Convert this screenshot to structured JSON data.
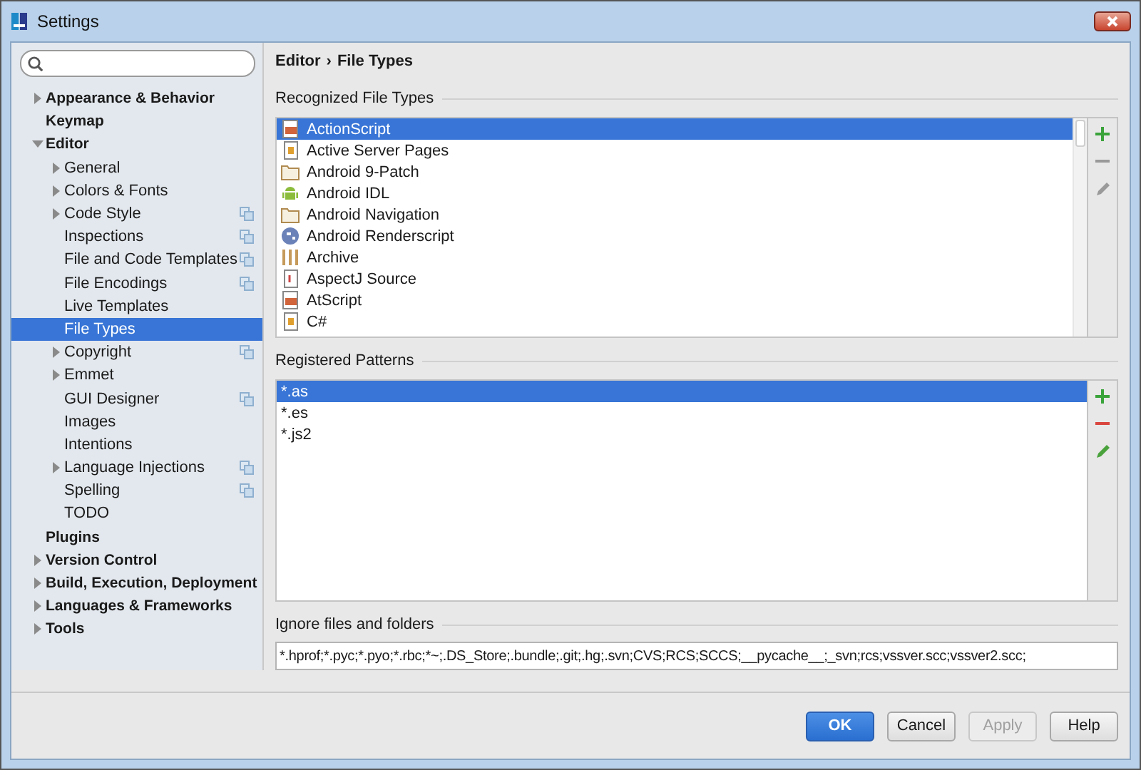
{
  "window": {
    "title": "Settings"
  },
  "sidebar": {
    "items": [
      {
        "label": "Appearance & Behavior",
        "expandable": true,
        "expanded": false,
        "selected": false,
        "project_scoped": false
      },
      {
        "label": "Keymap",
        "expandable": false,
        "expanded": false,
        "selected": false,
        "project_scoped": false
      },
      {
        "label": "Editor",
        "expandable": true,
        "expanded": true,
        "selected": false,
        "project_scoped": false,
        "children": [
          {
            "label": "General",
            "expandable": true,
            "expanded": false,
            "selected": false,
            "project_scoped": false
          },
          {
            "label": "Colors & Fonts",
            "expandable": true,
            "expanded": false,
            "selected": false,
            "project_scoped": false
          },
          {
            "label": "Code Style",
            "expandable": true,
            "expanded": false,
            "selected": false,
            "project_scoped": true
          },
          {
            "label": "Inspections",
            "expandable": false,
            "expanded": false,
            "selected": false,
            "project_scoped": true
          },
          {
            "label": "File and Code Templates",
            "expandable": false,
            "expanded": false,
            "selected": false,
            "project_scoped": true
          },
          {
            "label": "File Encodings",
            "expandable": false,
            "expanded": false,
            "selected": false,
            "project_scoped": true
          },
          {
            "label": "Live Templates",
            "expandable": false,
            "expanded": false,
            "selected": false,
            "project_scoped": false
          },
          {
            "label": "File Types",
            "expandable": false,
            "expanded": false,
            "selected": true,
            "project_scoped": false
          },
          {
            "label": "Copyright",
            "expandable": true,
            "expanded": false,
            "selected": false,
            "project_scoped": true
          },
          {
            "label": "Emmet",
            "expandable": true,
            "expanded": false,
            "selected": false,
            "project_scoped": false
          },
          {
            "label": "GUI Designer",
            "expandable": false,
            "expanded": false,
            "selected": false,
            "project_scoped": true
          },
          {
            "label": "Images",
            "expandable": false,
            "expanded": false,
            "selected": false,
            "project_scoped": false
          },
          {
            "label": "Intentions",
            "expandable": false,
            "expanded": false,
            "selected": false,
            "project_scoped": false
          },
          {
            "label": "Language Injections",
            "expandable": true,
            "expanded": false,
            "selected": false,
            "project_scoped": true
          },
          {
            "label": "Spelling",
            "expandable": false,
            "expanded": false,
            "selected": false,
            "project_scoped": true
          },
          {
            "label": "TODO",
            "expandable": false,
            "expanded": false,
            "selected": false,
            "project_scoped": false
          }
        ]
      },
      {
        "label": "Plugins",
        "expandable": false,
        "expanded": false,
        "selected": false,
        "project_scoped": false
      },
      {
        "label": "Version Control",
        "expandable": true,
        "expanded": false,
        "selected": false,
        "project_scoped": false
      },
      {
        "label": "Build, Execution, Deployment",
        "expandable": true,
        "expanded": false,
        "selected": false,
        "project_scoped": false
      },
      {
        "label": "Languages & Frameworks",
        "expandable": true,
        "expanded": false,
        "selected": false,
        "project_scoped": false
      },
      {
        "label": "Tools",
        "expandable": true,
        "expanded": false,
        "selected": false,
        "project_scoped": false
      }
    ]
  },
  "breadcrumb": {
    "parts": [
      "Editor",
      "File Types"
    ],
    "separator": "›"
  },
  "recognized_file_types": {
    "title": "Recognized File Types",
    "items": [
      {
        "label": "ActionScript",
        "kind": "badge",
        "selected": true
      },
      {
        "label": "Active Server Pages",
        "kind": "document",
        "selected": false
      },
      {
        "label": "Android 9-Patch",
        "kind": "folder",
        "selected": false
      },
      {
        "label": "Android IDL",
        "kind": "android",
        "selected": false
      },
      {
        "label": "Android Navigation",
        "kind": "folder",
        "selected": false
      },
      {
        "label": "Android Renderscript",
        "kind": "circle",
        "selected": false
      },
      {
        "label": "Archive",
        "kind": "archive",
        "selected": false
      },
      {
        "label": "AspectJ Source",
        "kind": "plain",
        "selected": false
      },
      {
        "label": "AtScript",
        "kind": "badge",
        "selected": false
      },
      {
        "label": "C#",
        "kind": "document",
        "selected": false
      }
    ],
    "toolbar": [
      {
        "kind": "add",
        "disabled": false
      },
      {
        "kind": "remove",
        "disabled": true
      },
      {
        "kind": "edit",
        "disabled": true
      }
    ]
  },
  "registered_patterns": {
    "title": "Registered Patterns",
    "items": [
      {
        "label": "*.as",
        "selected": true
      },
      {
        "label": "*.es",
        "selected": false
      },
      {
        "label": "*.js2",
        "selected": false
      }
    ],
    "toolbar": [
      {
        "kind": "add",
        "disabled": false
      },
      {
        "kind": "remove",
        "disabled": false
      },
      {
        "kind": "edit",
        "disabled": false
      }
    ]
  },
  "ignore_files": {
    "label": "Ignore files and folders",
    "value": "*.hprof;*.pyc;*.pyo;*.rbc;*~;.DS_Store;.bundle;.git;.hg;.svn;CVS;RCS;SCCS;__pycache__;_svn;rcs;vssver.scc;vssver2.scc;"
  },
  "buttons": [
    {
      "label": "OK",
      "kind": "primary",
      "disabled": false
    },
    {
      "label": "Cancel",
      "kind": "normal",
      "disabled": false
    },
    {
      "label": "Apply",
      "kind": "normal",
      "disabled": true
    },
    {
      "label": "Help",
      "kind": "normal",
      "disabled": false
    }
  ]
}
